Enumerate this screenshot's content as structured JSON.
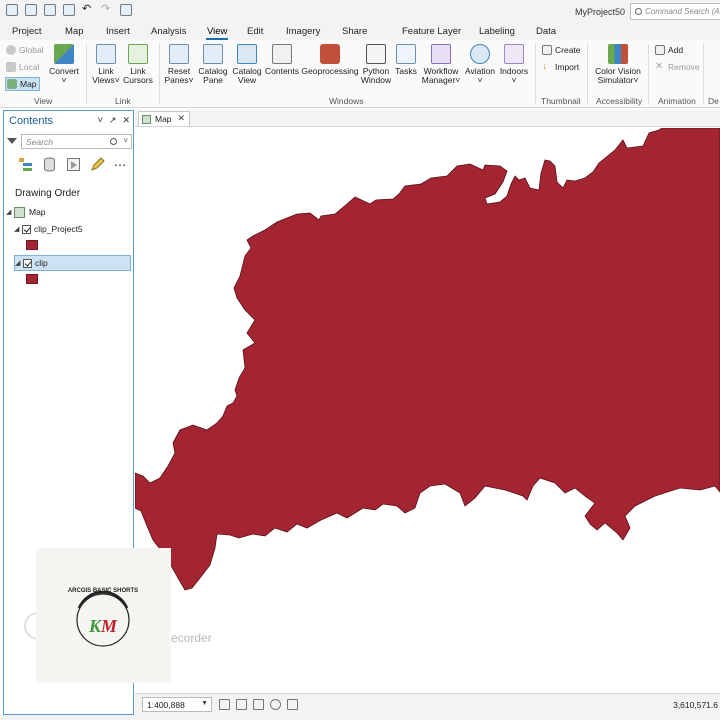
{
  "app": {
    "project_title": "MyProject50",
    "command_search_placeholder": "Command Search (Alt"
  },
  "tabs": [
    {
      "label": "Project",
      "active": false
    },
    {
      "label": "Map",
      "active": false
    },
    {
      "label": "Insert",
      "active": false
    },
    {
      "label": "Analysis",
      "active": false
    },
    {
      "label": "View",
      "active": true
    },
    {
      "label": "Edit",
      "active": false
    },
    {
      "label": "Imagery",
      "active": false
    },
    {
      "label": "Share",
      "active": false
    },
    {
      "label": "Feature Layer",
      "active": false
    },
    {
      "label": "Labeling",
      "active": false
    },
    {
      "label": "Data",
      "active": false
    }
  ],
  "ribbon": {
    "view_group": {
      "label": "View",
      "global": "Global",
      "local": "Local",
      "map": "Map",
      "convert": "Convert"
    },
    "link_group": {
      "label": "Link",
      "link_views_1": "Link",
      "link_views_2": "Views",
      "link_cursors_1": "Link",
      "link_cursors_2": "Cursors"
    },
    "windows_group": {
      "label": "Windows",
      "reset_panes_1": "Reset",
      "reset_panes_2": "Panes",
      "catalog_pane_1": "Catalog",
      "catalog_pane_2": "Pane",
      "catalog_view_1": "Catalog",
      "catalog_view_2": "View",
      "contents": "Contents",
      "geoprocessing": "Geoprocessing",
      "python_window_1": "Python",
      "python_window_2": "Window",
      "tasks": "Tasks",
      "workflow_manager_1": "Workflow",
      "workflow_manager_2": "Manager",
      "aviation": "Aviation",
      "indoors": "Indoors"
    },
    "thumbnail_group": {
      "label": "Thumbnail",
      "create": "Create",
      "import": "Import"
    },
    "accessibility_group": {
      "label": "Accessibility",
      "color_vision_1": "Color Vision",
      "color_vision_2": "Simulator"
    },
    "animation_group": {
      "label": "Animation",
      "add": "Add",
      "remove": "Remove"
    },
    "cut_group_label": "De"
  },
  "contents_pane": {
    "title": "Contents",
    "search_placeholder": "Search",
    "drawing_order": "Drawing Order",
    "map_name": "Map",
    "layers": [
      {
        "name": "clip_Project5",
        "checked": true,
        "selected": false,
        "color": "#a32532"
      },
      {
        "name": "clip",
        "checked": true,
        "selected": true,
        "color": "#a32532"
      }
    ]
  },
  "map_view": {
    "tab_label": "Map",
    "fill_color": "#a32532",
    "stroke_color": "#5a1018"
  },
  "status_bar": {
    "scale": "1:400,888",
    "coordinates": "3,610,571.6"
  },
  "overlay": {
    "recorder_text": "ecorder",
    "logo_text": "ARCGIS BASIC SHORTS",
    "logo_letters": "KM"
  }
}
